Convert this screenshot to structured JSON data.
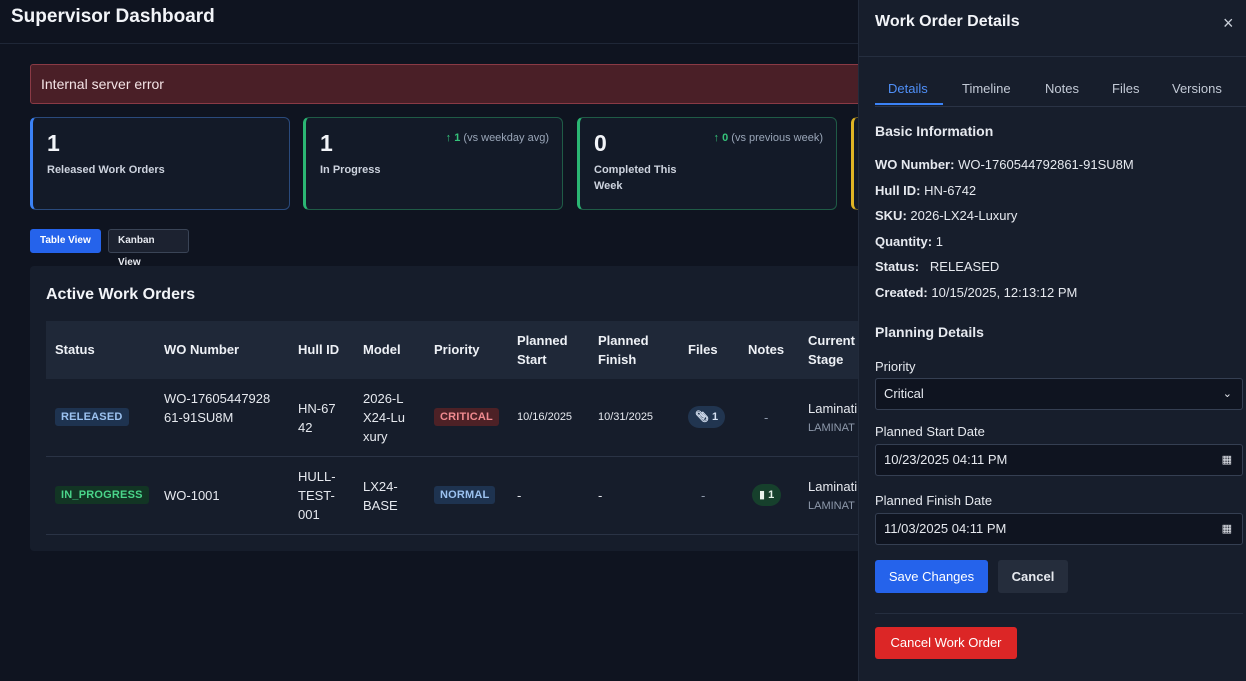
{
  "header": {
    "title": "Supervisor Dashboard"
  },
  "error": {
    "message": "Internal server error"
  },
  "stats": [
    {
      "value": "1",
      "label": "Released Work Orders",
      "delta_value": "",
      "delta_note": ""
    },
    {
      "value": "1",
      "label": "In Progress",
      "delta_value": "↑ 1",
      "delta_note": "(vs weekday avg)"
    },
    {
      "value": "0",
      "label": "Completed This Week",
      "delta_value": "↑ 0",
      "delta_note": "(vs previous week)"
    }
  ],
  "views": {
    "table": "Table View",
    "kanban": "Kanban View"
  },
  "table": {
    "title": "Active Work Orders",
    "columns": [
      "Status",
      "WO Number",
      "Hull ID",
      "Model",
      "Priority",
      "Planned Start",
      "Planned Finish",
      "Files",
      "Notes",
      "Current Stage"
    ],
    "rows": [
      {
        "status": "RELEASED",
        "wo": "WO-1760544792861-91SU8M",
        "hull": "HN-6742",
        "model": "2026-LX24-Luxury",
        "priority": "CRITICAL",
        "start": "10/16/2025",
        "finish": "10/31/2025",
        "files": "1",
        "notes": "-",
        "stage": "Laminati",
        "stage_sub": "LAMINAT"
      },
      {
        "status": "IN_PROGRESS",
        "wo": "WO-1001",
        "hull": "HULL-TEST-001",
        "model": "LX24-BASE",
        "priority": "NORMAL",
        "start": "-",
        "finish": "-",
        "files": "-",
        "notes": "1",
        "stage": "Laminati",
        "stage_sub": "LAMINAT"
      }
    ]
  },
  "drawer": {
    "title": "Work Order Details",
    "close": "×",
    "tabs": [
      "Details",
      "Timeline",
      "Notes",
      "Files",
      "Versions"
    ],
    "basic_title": "Basic Information",
    "basic": [
      {
        "key": "WO Number:",
        "val": "WO-1760544792861-91SU8M"
      },
      {
        "key": "Hull ID:",
        "val": "HN-6742"
      },
      {
        "key": "SKU:",
        "val": "2026-LX24-Luxury"
      },
      {
        "key": "Quantity:",
        "val": "1"
      },
      {
        "key": "Status:",
        "val": "RELEASED"
      },
      {
        "key": "Created:",
        "val": "10/15/2025, 12:13:12 PM"
      }
    ],
    "planning_title": "Planning Details",
    "priority_label": "Priority",
    "priority_value": "Critical",
    "start_label": "Planned Start Date",
    "start_value": "10/23/2025 04:11 PM",
    "finish_label": "Planned Finish Date",
    "finish_value": "11/03/2025 04:11 PM",
    "save": "Save Changes",
    "cancel": "Cancel",
    "cancel_wo": "Cancel Work Order"
  },
  "colors": {
    "accent": "#3b82f6",
    "danger": "#dc2626",
    "success": "#2bb673",
    "warning": "#e0b424"
  }
}
